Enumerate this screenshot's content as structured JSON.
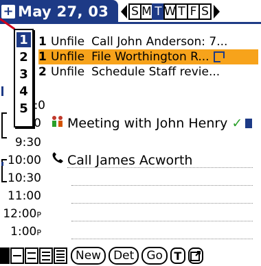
{
  "header": {
    "title": "May 27, 03",
    "app_icon": "plus-box-icon",
    "week_days": [
      "S",
      "M",
      "T",
      "W",
      "T",
      "F",
      "S"
    ],
    "selected_day_index": 2,
    "prev_icon": "left-triangle-icon",
    "next_icon": "right-triangle-icon"
  },
  "priority_popup": {
    "items": [
      "1",
      "2",
      "3",
      "4",
      "5"
    ],
    "selected_index": 0
  },
  "todos": [
    {
      "priority": "1",
      "category": "Unfile",
      "text": "Call John Anderson: 7...",
      "selected": false
    },
    {
      "priority": "1",
      "category": "Unfile",
      "text": "File Worthington R...",
      "selected": true,
      "has_note": true
    },
    {
      "priority": "2",
      "category": "Unfile",
      "text": "Schedule Staff revie...",
      "selected": false
    }
  ],
  "schedule": {
    "times": [
      "9:00",
      "9:30",
      "10:00",
      "10:30",
      "11:00",
      "12:00",
      "1:00"
    ],
    "partial_time_label": ":0",
    "events": [
      {
        "text": "Meeting with John Henry",
        "icon": "people-icon",
        "done": true
      },
      {
        "text": "Call James Acworth",
        "icon": "phone-icon"
      }
    ]
  },
  "toolbar": {
    "new_label": "New",
    "details_label": "Det",
    "go_label": "Go",
    "todo_label": "T",
    "views": [
      "day-view-icon",
      "week-view-icon",
      "month-view-icon",
      "list-view-icon",
      "agenda-view-icon"
    ]
  },
  "colors": {
    "accent": "#1d3a86",
    "highlight": "#f7a31b",
    "check": "#2aa02a"
  }
}
